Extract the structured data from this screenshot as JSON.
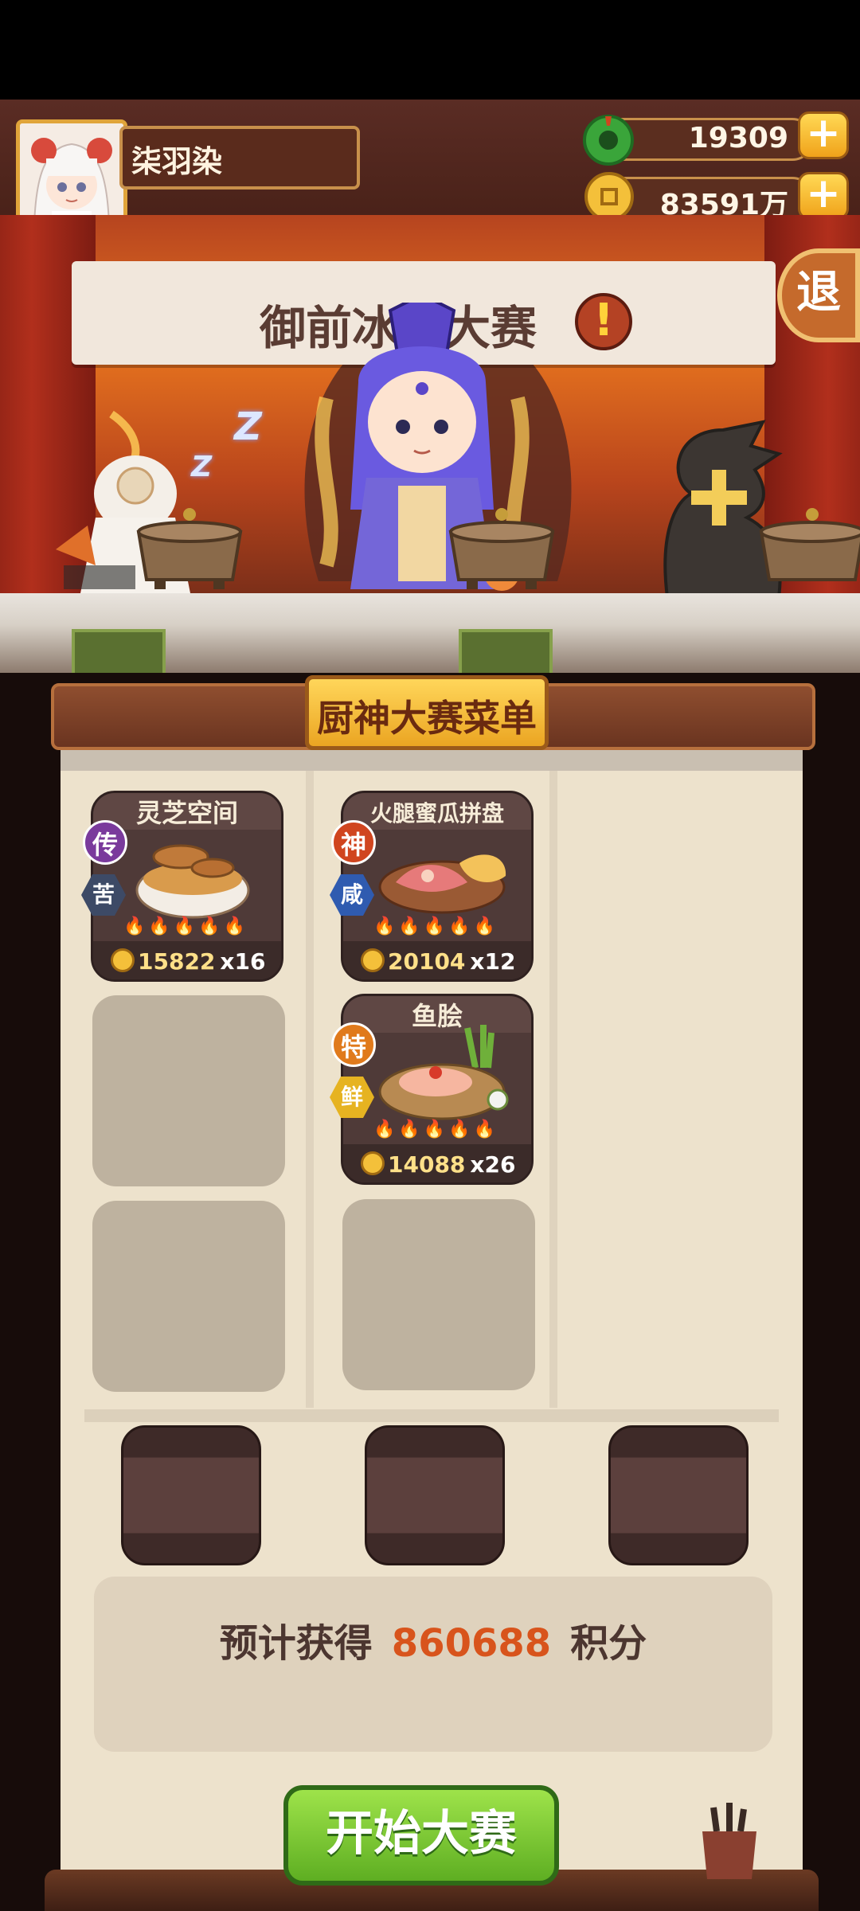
{
  "player": {
    "name": "柒羽染"
  },
  "resources": {
    "jade": {
      "value": "19309",
      "icon": "jade-coin-icon"
    },
    "coins": {
      "value": "83591万",
      "icon": "gold-coin-icon"
    }
  },
  "stage": {
    "banner_title": "御前冰吧大赛",
    "alert_icon": "!",
    "exit_label": "退",
    "zzz": [
      "Z",
      "Z"
    ],
    "add_slot_icon": "+"
  },
  "menu": {
    "title": "厨神大赛菜单",
    "dishes": [
      {
        "name": "灵芝空间",
        "tier": "传",
        "flavor": "苦",
        "price": "15822",
        "qty": "x16",
        "tier_color": "#7a3a9c",
        "flavor_color": "#3d4a66"
      },
      {
        "name": "火腿蜜瓜拼盘",
        "tier": "神",
        "flavor": "咸",
        "price": "20104",
        "qty": "x12",
        "tier_color": "#d0451f",
        "flavor_color": "#2f5bb0"
      },
      {
        "name": "鱼脍",
        "tier": "特",
        "flavor": "鲜",
        "price": "14088",
        "qty": "x26",
        "tier_color": "#e07a1c",
        "flavor_color": "#e6b321"
      }
    ],
    "flames": "🔥🔥🔥🔥🔥"
  },
  "score": {
    "prefix": "预计获得",
    "value": "860688",
    "suffix": "积分"
  },
  "start_button": "开始大赛",
  "colors": {
    "accent": "#d8541c",
    "start_green": "#5eae22",
    "gold": "#f0a21a"
  }
}
